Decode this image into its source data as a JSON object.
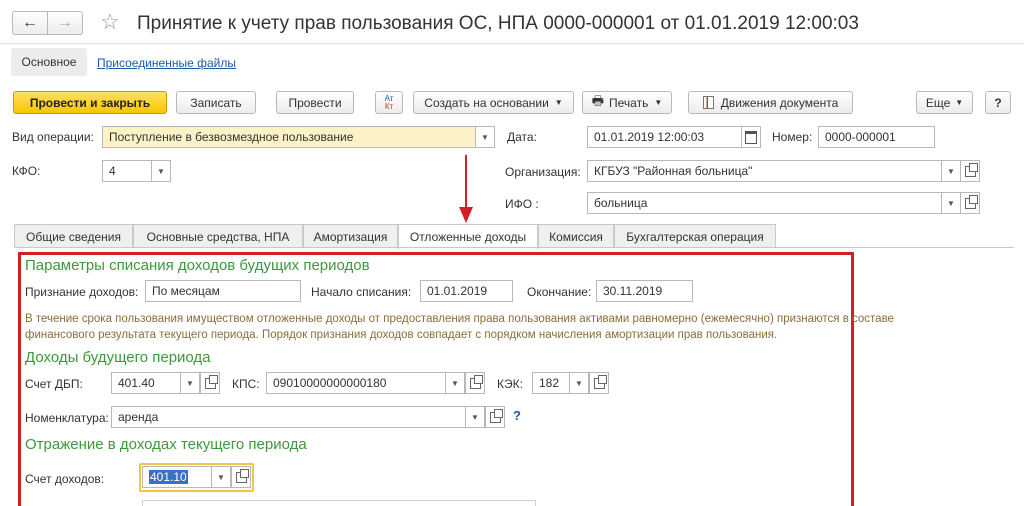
{
  "window": {
    "title": "Принятие к учету прав пользования ОС, НПА 0000-000001 от 01.01.2019 12:00:03",
    "nav_back": "←",
    "nav_forward": "→",
    "star": "☆"
  },
  "top_tabs": {
    "main": "Основное",
    "files": "Присоединенные файлы"
  },
  "toolbar": {
    "post_close": "Провести и закрыть",
    "save": "Записать",
    "post": "Провести",
    "at_kt_top": "Ат",
    "at_kt_bottom": "Кт",
    "create_based": "Создать на основании",
    "print": "Печать",
    "movements": "Движения документа",
    "more": "Еще",
    "help": "?"
  },
  "header": {
    "operation_label": "Вид операции:",
    "operation_value": "Поступление в безвозмездное пользование",
    "date_label": "Дата:",
    "date_value": "01.01.2019 12:00:03",
    "number_label": "Номер:",
    "number_value": "0000-000001",
    "kfo_label": "КФО:",
    "kfo_value": "4",
    "org_label": "Организация:",
    "org_value": "КГБУЗ \"Районная больница\"",
    "ifo_label": "ИФО :",
    "ifo_value": "больница"
  },
  "tabs": [
    "Общие сведения",
    "Основные средства, НПА",
    "Амортизация",
    "Отложенные доходы",
    "Комиссия",
    "Бухгалтерская операция"
  ],
  "deferred": {
    "section1_title": "Параметры списания доходов будущих периодов",
    "recognition_label": "Признание доходов:",
    "recognition_value": "По месяцам",
    "start_label": "Начало списания:",
    "start_value": "01.01.2019",
    "end_label": "Окончание:",
    "end_value": "30.11.2019",
    "info_line1": "В течение срока пользования имуществом отложенные доходы от предоставления права пользования активами равномерно (ежемесячно) признаются в составе",
    "info_line2": "финансового результата текущего периода. Порядок признания доходов совпадает с порядком начисления амортизации прав пользования.",
    "section2_title": "Доходы будущего периода",
    "dbp_label": "Счет ДБП:",
    "dbp_value": "401.40",
    "kps_label": "КПС:",
    "kps_value": "09010000000000180",
    "kek_label": "КЭК:",
    "kek_value": "182",
    "nomenclature_label": "Номенклатура:",
    "nomenclature_value": "аренда",
    "help_q": "?",
    "section3_title": "Отражение в доходах текущего периода",
    "income_label": "Счет доходов:",
    "income_value": "401.10"
  },
  "colors": {
    "accent_yellow": "#f7c600",
    "highlight_red": "#d21f26",
    "section_green": "#3b9a3b"
  }
}
